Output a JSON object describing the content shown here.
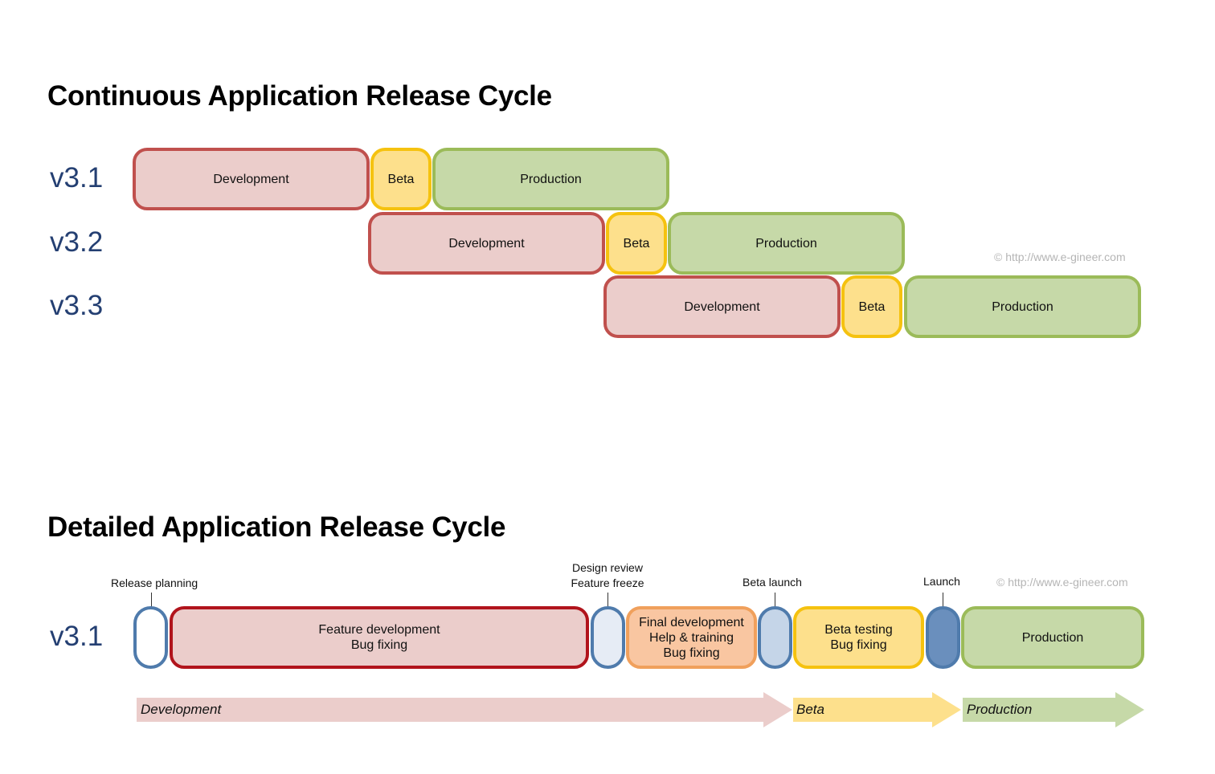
{
  "continuous": {
    "title": "Continuous Application Release Cycle",
    "copyright": "© http://www.e-gineer.com",
    "versions": [
      {
        "version": "v3.1",
        "phases": [
          "Development",
          "Beta",
          "Production"
        ]
      },
      {
        "version": "v3.2",
        "phases": [
          "Development",
          "Beta",
          "Production"
        ]
      },
      {
        "version": "v3.3",
        "phases": [
          "Development",
          "Beta",
          "Production"
        ]
      }
    ]
  },
  "detailed": {
    "title": "Detailed Application Release Cycle",
    "copyright": "© http://www.e-gineer.com",
    "version": "v3.1",
    "milestones": {
      "release_planning": "Release planning",
      "design_review": [
        "Design review",
        "Feature freeze"
      ],
      "beta_launch": "Beta launch",
      "launch": "Launch"
    },
    "stages": {
      "feature_dev": [
        "Feature development",
        "Bug fixing"
      ],
      "final_dev": [
        "Final development",
        "Help & training",
        "Bug fixing"
      ],
      "beta_testing": [
        "Beta testing",
        "Bug fixing"
      ],
      "production": "Production"
    },
    "arrows": [
      "Development",
      "Beta",
      "Production"
    ]
  },
  "colors": {
    "dev_fill": "#ebcdcb",
    "dev_border": "#c0504d",
    "beta_fill": "#fde08c",
    "beta_border": "#f5c20f",
    "prod_fill": "#c6d9a8",
    "prod_border": "#9bbb59",
    "milestone_border": "#4f7bac",
    "version_text": "#243f72"
  }
}
